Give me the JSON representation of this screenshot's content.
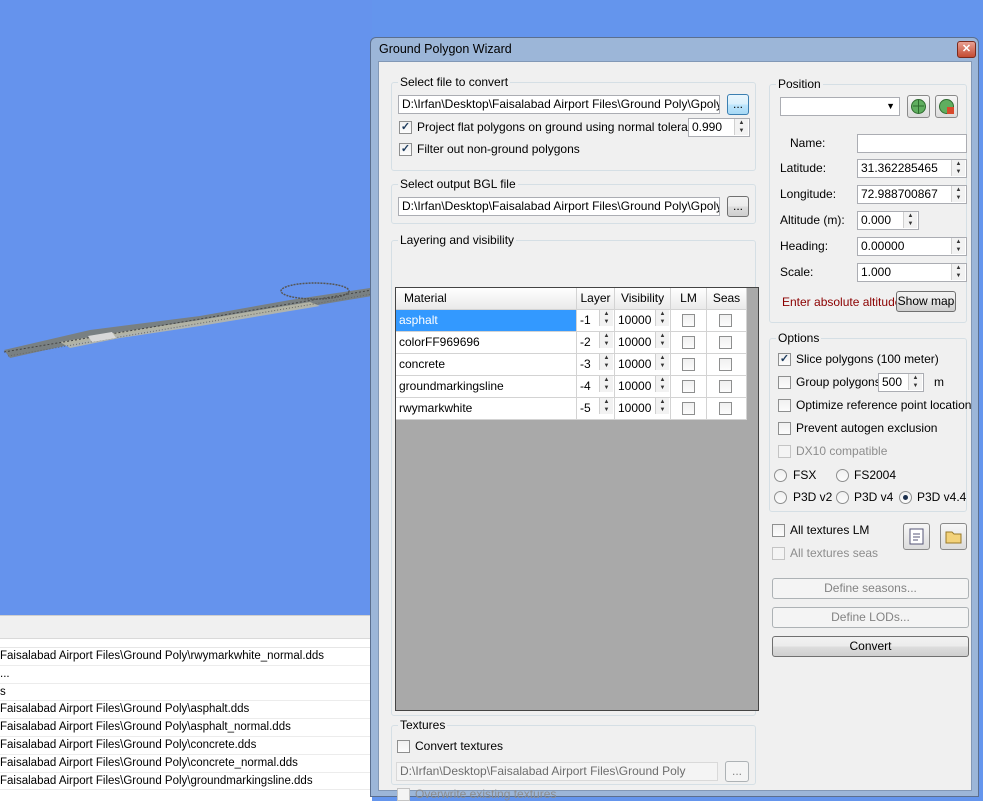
{
  "window": {
    "title": "Ground Polygon Wizard",
    "close_icon": "close-icon"
  },
  "select_file": {
    "label": "Select file to convert",
    "path": "D:\\Irfan\\Desktop\\Faisalabad Airport Files\\Ground Poly\\Gpoly.BGL",
    "browse_label": "...",
    "project_flat_label": "Project flat polygons on ground using normal tolerance:",
    "project_flat_checked": true,
    "tolerance": "0.990",
    "filter_label": "Filter out non-ground polygons",
    "filter_checked": true
  },
  "output": {
    "label": "Select output BGL file",
    "path": "D:\\Irfan\\Desktop\\Faisalabad Airport Files\\Ground Poly\\Gpoly.bgl",
    "browse_label": "..."
  },
  "layering": {
    "label": "Layering and visibility",
    "columns": [
      "Material",
      "Layer",
      "Visibility",
      "LM",
      "Seas"
    ],
    "rows": [
      {
        "material": "asphalt",
        "layer": "-1",
        "visibility": "10000",
        "lm": false,
        "seas": false,
        "selected": true
      },
      {
        "material": "colorFF969696",
        "layer": "-2",
        "visibility": "10000",
        "lm": false,
        "seas": false,
        "selected": false
      },
      {
        "material": "concrete",
        "layer": "-3",
        "visibility": "10000",
        "lm": false,
        "seas": false,
        "selected": false
      },
      {
        "material": "groundmarkingsline",
        "layer": "-4",
        "visibility": "10000",
        "lm": false,
        "seas": false,
        "selected": false
      },
      {
        "material": "rwymarkwhite",
        "layer": "-5",
        "visibility": "10000",
        "lm": false,
        "seas": false,
        "selected": false
      }
    ]
  },
  "textures": {
    "label": "Textures",
    "convert_label": "Convert textures",
    "path": "D:\\Irfan\\Desktop\\Faisalabad Airport Files\\Ground Poly",
    "browse_label": "...",
    "overwrite_label": "Overwrite existing textures"
  },
  "position": {
    "label": "Position",
    "name_label": "Name:",
    "name_value": "",
    "latitude_label": "Latitude:",
    "latitude": "31.362285465",
    "longitude_label": "Longitude:",
    "longitude": "72.988700867",
    "altitude_label": "Altitude (m):",
    "altitude": "0.000",
    "heading_label": "Heading:",
    "heading": "0.00000",
    "scale_label": "Scale:",
    "scale": "1.000",
    "warning": "Enter absolute altitude!",
    "warning_color": "#8b0000",
    "show_map_label": "Show map"
  },
  "options": {
    "label": "Options",
    "slice_label": "Slice polygons (100 meter)",
    "slice_checked": true,
    "group_label": "Group polygons",
    "group_value": "500",
    "group_unit": "m",
    "optimize_label": "Optimize reference point location",
    "autogen_label": "Prevent autogen exclusion",
    "dx10_label": "DX10 compatible",
    "sims": [
      "FSX",
      "FS2004",
      "P3D v2",
      "P3D v4",
      "P3D v4.4"
    ],
    "selected_sim": "P3D v4.4"
  },
  "bottom": {
    "all_lm_label": "All textures LM",
    "all_seas_label": "All textures seas",
    "define_seasons_label": "Define seasons...",
    "define_lods_label": "Define LODs...",
    "convert_label": "Convert"
  },
  "log": {
    "rows": [
      "Faisalabad Airport Files\\Ground Poly\\rwymarkwhite_normal.dds",
      "...",
      "s",
      "Faisalabad Airport Files\\Ground Poly\\asphalt.dds",
      "Faisalabad Airport Files\\Ground Poly\\asphalt_normal.dds",
      "Faisalabad Airport Files\\Ground Poly\\concrete.dds",
      "Faisalabad Airport Files\\Ground Poly\\concrete_normal.dds",
      "Faisalabad Airport Files\\Ground Poly\\groundmarkingsline.dds"
    ]
  },
  "colors": {
    "sky": "#6495ED",
    "selection": "#3399ff"
  }
}
